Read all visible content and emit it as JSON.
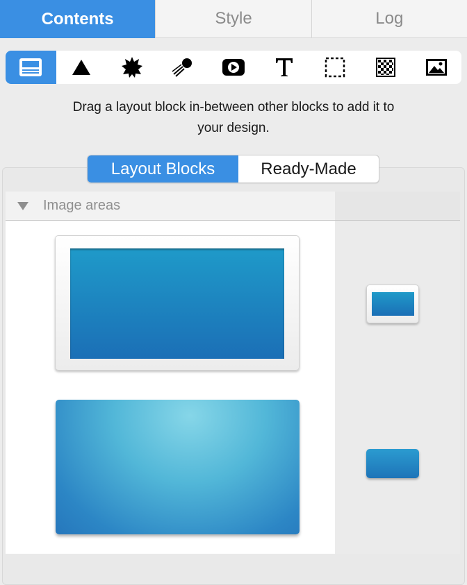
{
  "tabs": [
    {
      "label": "Contents",
      "active": true
    },
    {
      "label": "Style",
      "active": false
    },
    {
      "label": "Log",
      "active": false
    }
  ],
  "toolbar": {
    "items": [
      {
        "icon": "layout-block-icon",
        "active": true
      },
      {
        "icon": "triangle-shape-icon",
        "active": false
      },
      {
        "icon": "starburst-icon",
        "active": false
      },
      {
        "icon": "comet-effect-icon",
        "active": false
      },
      {
        "icon": "video-play-icon",
        "active": false
      },
      {
        "icon": "text-icon",
        "active": false
      },
      {
        "icon": "selection-box-icon",
        "active": false
      },
      {
        "icon": "checkerboard-pattern-icon",
        "active": false
      },
      {
        "icon": "image-icon",
        "active": false
      }
    ]
  },
  "hint": {
    "line1": "Drag a layout block in-between other blocks to add it to",
    "line2": "your design."
  },
  "library": {
    "segments": {
      "layout_blocks": "Layout Blocks",
      "ready_made": "Ready-Made",
      "selected": "Layout Blocks"
    },
    "section": {
      "title": "Image areas",
      "expanded": true
    }
  },
  "colors": {
    "accent": "#3a8fe3",
    "image_blue": "#1b6fb6",
    "image_light_blue": "#52b7d8"
  }
}
